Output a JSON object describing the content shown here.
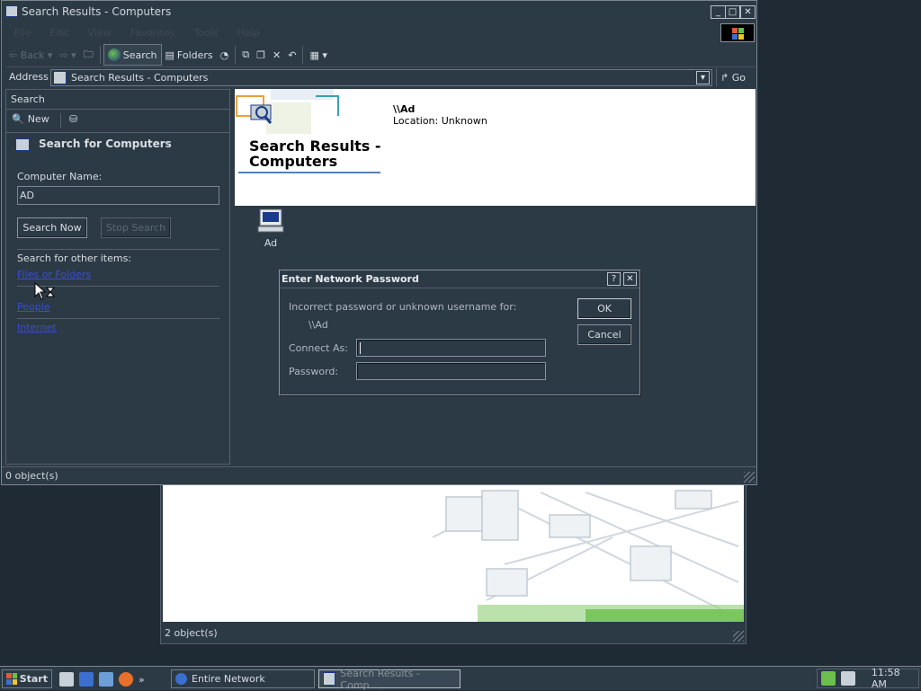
{
  "main_window": {
    "title": "Search Results - Computers",
    "menu": [
      "File",
      "Edit",
      "View",
      "Favorites",
      "Tools",
      "Help"
    ],
    "controls": {
      "minimize": "_",
      "maximize": "□",
      "close": "✕"
    },
    "toolbar": {
      "back": "Back",
      "search": "Search",
      "folders": "Folders"
    },
    "address": {
      "label": "Address",
      "value": "Search Results - Computers",
      "go": "Go"
    },
    "status": "0 object(s)"
  },
  "search_pane": {
    "header": "Search",
    "new_label": "New",
    "section_title": "Search for Computers",
    "computer_name_label": "Computer Name:",
    "computer_name_value": "AD",
    "search_now": "Search Now",
    "stop_search": "Stop Search",
    "other_items_label": "Search for other items:",
    "links": [
      "Files or Folders",
      "People",
      "Internet"
    ]
  },
  "results": {
    "banner_title_line1": "Search Results -",
    "banner_title_line2": "Computers",
    "item_path": "\\\\Ad",
    "item_location": "Location: Unknown",
    "item_label": "Ad"
  },
  "dialog": {
    "title": "Enter Network Password",
    "help": "?",
    "close": "✕",
    "message": "Incorrect password or unknown username for:",
    "resource": "\\\\Ad",
    "connect_as_label": "Connect As:",
    "connect_as_value": "",
    "password_label": "Password:",
    "password_value": "",
    "ok": "OK",
    "cancel": "Cancel"
  },
  "bg_window": {
    "status": "2 object(s)"
  },
  "taskbar": {
    "start": "Start",
    "tasks": [
      "Entire Network",
      "Search Results - Comp..."
    ],
    "clock": "11:58 AM",
    "chevron": "»"
  }
}
